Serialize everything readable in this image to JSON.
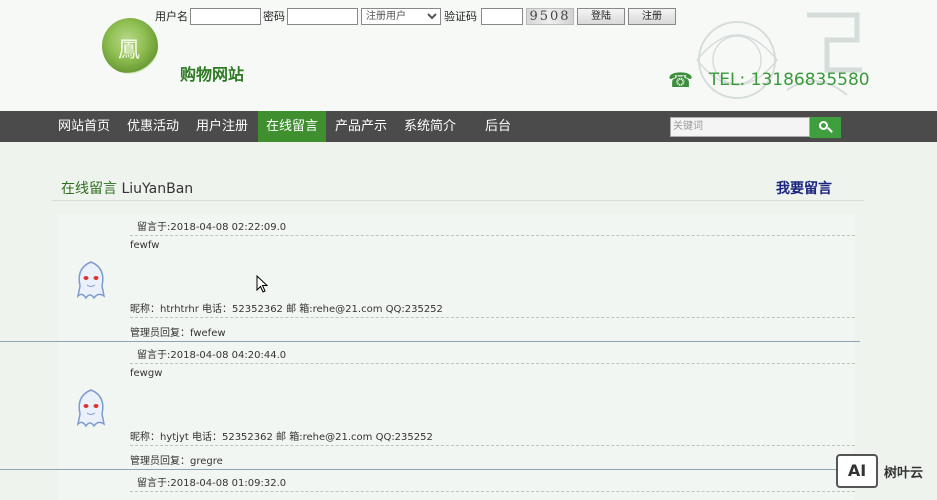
{
  "header": {
    "site_name": "购物网站",
    "logo_char": "鳳",
    "login": {
      "username_label": "用户名",
      "password_label": "密码",
      "role_selected": "注册用户",
      "captcha_label": "验证码",
      "captcha_code": "9508",
      "login_button": "登陆",
      "register_button": "注册"
    },
    "phone": "TEL: 13186835580"
  },
  "nav": {
    "items": [
      "网站首页",
      "优惠活动",
      "用户注册",
      "在线留言",
      "产品产示",
      "系统简介",
      "后台"
    ],
    "active_index": 3,
    "search_placeholder": "关键词"
  },
  "section": {
    "title_cn": "在线留言",
    "title_en": "LiuYanBan",
    "leave_message": "我要留言"
  },
  "messages": [
    {
      "posted": "留言于:2018-04-08 02:22:09.0",
      "content": "fewfw",
      "info": "昵称：htrhtrhr   电话：52352362  邮 箱:rehe@21.com   QQ:235252",
      "reply": "管理员回复：fwefew"
    },
    {
      "posted": "留言于:2018-04-08 04:20:44.0",
      "content": "fewgw",
      "info": "昵称：hytjyt   电话：52352362  邮 箱:rehe@21.com   QQ:235252",
      "reply": "管理员回复：gregre"
    },
    {
      "posted": "留言于:2018-04-08 01:09:32.0"
    }
  ],
  "watermark": {
    "logo": "AI",
    "text": "树叶云"
  },
  "colors": {
    "nav_bg": "#4b4b4b",
    "nav_active": "#3f8f2f",
    "brand_green": "#2f7a25",
    "phone_green": "#3a9a3a"
  }
}
